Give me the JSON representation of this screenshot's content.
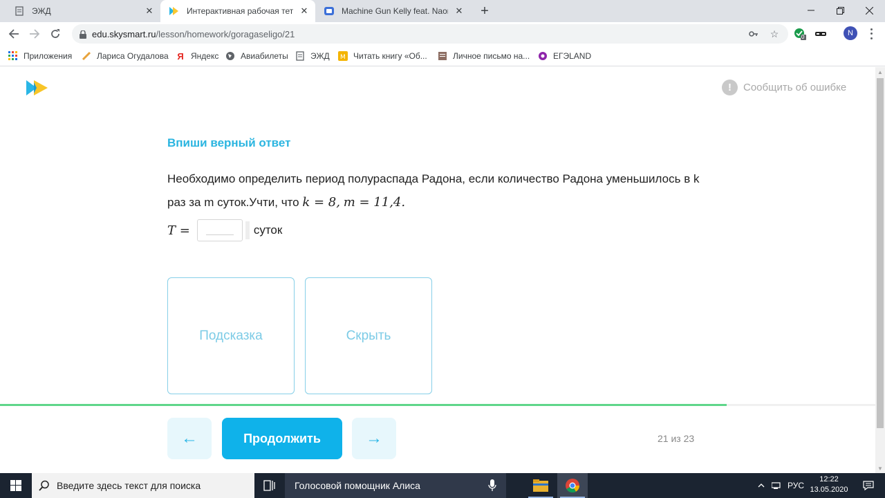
{
  "browser": {
    "tabs": [
      {
        "title": "ЭЖД",
        "active": false
      },
      {
        "title": "Интерактивная рабочая тетрадь",
        "active": true
      },
      {
        "title": "Machine Gun Kelly feat. Naomi Wild",
        "active": false
      }
    ],
    "url_host": "edu.skysmart.ru",
    "url_path": "/lesson/homework/goragaseligo/21",
    "profile_initial": "N",
    "extension_badge": "0",
    "bookmarks": [
      {
        "label": "Приложения",
        "icon": "apps-grid-icon"
      },
      {
        "label": "Лариса Огудалова",
        "icon": "pen-icon"
      },
      {
        "label": "Яндекс",
        "icon": "yandex-icon"
      },
      {
        "label": "Авиабилеты",
        "icon": "globe-icon"
      },
      {
        "label": "ЭЖД",
        "icon": "document-icon"
      },
      {
        "label": "Читать книгу «Об...",
        "icon": "book-icon"
      },
      {
        "label": "Личное письмо на...",
        "icon": "letter-icon"
      },
      {
        "label": "ЕГЭLAND",
        "icon": "circle-icon"
      }
    ]
  },
  "page": {
    "report_label": "Сообщить об ошибке",
    "task_title": "Впиши верный ответ",
    "task_text_line1": "Необходимо определить период полураспада Радона, если количество Радона уменьшилось в k",
    "task_text_line2": "раз за m суток.Учти, что",
    "formula_k": "k = 8",
    "formula_m": "m = 11,4",
    "answer_label": "T =",
    "answer_value": "",
    "answer_unit": "суток",
    "hint_label": "Подсказка",
    "hide_label": "Скрыть",
    "continue_label": "Продолжить",
    "prev_arrow": "←",
    "next_arrow": "→",
    "counter": "21 из 23",
    "progress": 0.83
  },
  "taskbar": {
    "search_placeholder": "Введите здесь текст для поиска",
    "assistant_label": "Голосовой помощник Алиса",
    "lang": "РУС",
    "time": "12:22",
    "date": "13.05.2020"
  }
}
